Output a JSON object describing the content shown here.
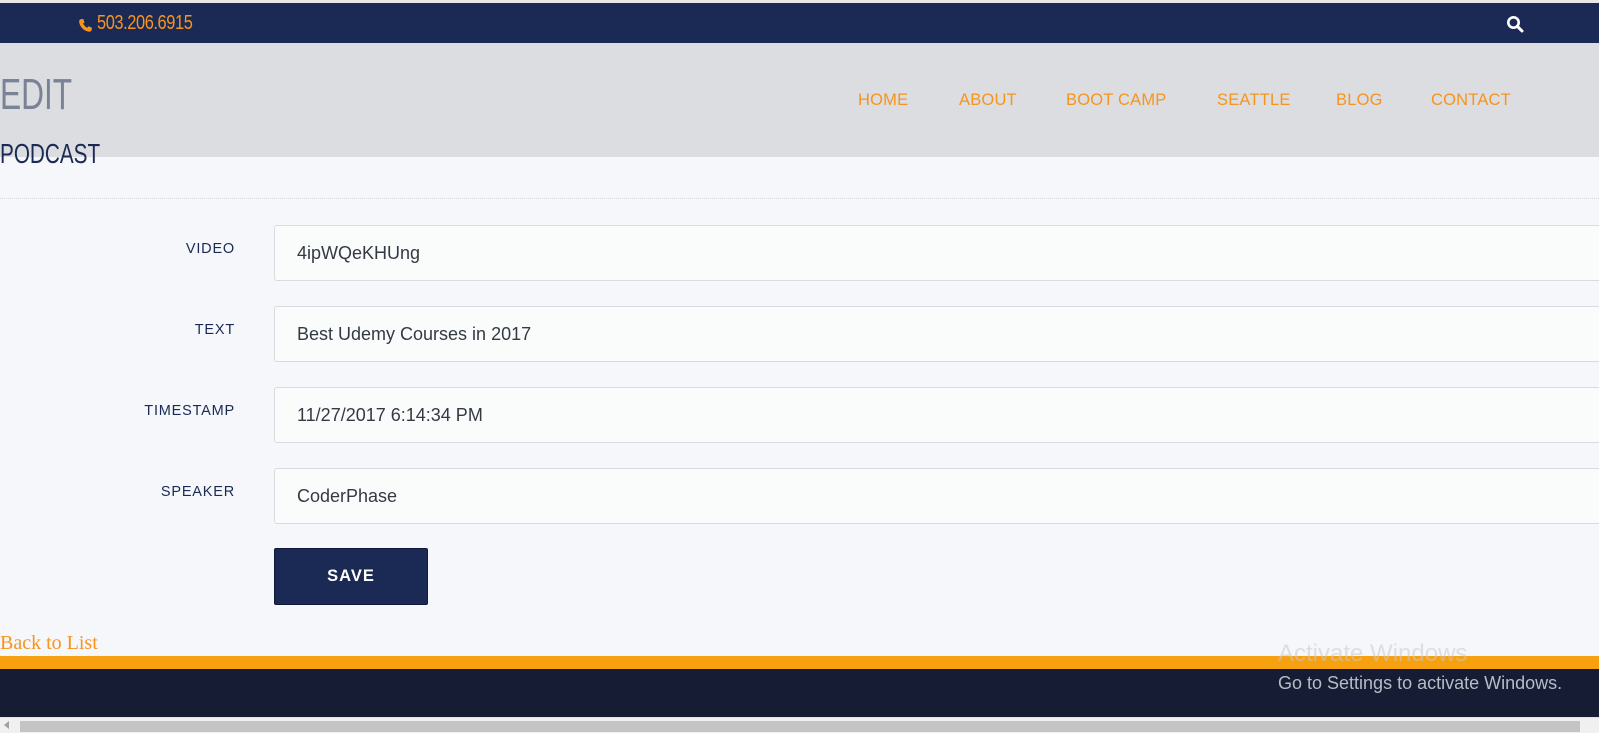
{
  "topbar": {
    "phone": "503.206.6915",
    "phone_icon": "phone-icon",
    "search_icon": "search-icon"
  },
  "header": {
    "title_line1": "EDIT",
    "title_line2": "PODCAST"
  },
  "nav": {
    "items": [
      "HOME",
      "ABOUT",
      "BOOT CAMP",
      "SEATTLE",
      "BLOG",
      "CONTACT"
    ]
  },
  "form": {
    "fields": [
      {
        "label": "VIDEO",
        "value": "4ipWQeKHUng"
      },
      {
        "label": "TEXT",
        "value": "Best Udemy Courses in 2017"
      },
      {
        "label": "TIMESTAMP",
        "value": "11/27/2017 6:14:34 PM"
      },
      {
        "label": "SPEAKER",
        "value": "CoderPhase"
      }
    ],
    "save_label": "SAVE"
  },
  "back_link": "Back to List",
  "watermark": {
    "title": "Activate Windows",
    "subtitle": "Go to Settings to activate Windows."
  },
  "colors": {
    "navy": "#1b2a55",
    "accent": "#f7941d",
    "footer": "#151c33",
    "stripe": "#f7a111"
  }
}
